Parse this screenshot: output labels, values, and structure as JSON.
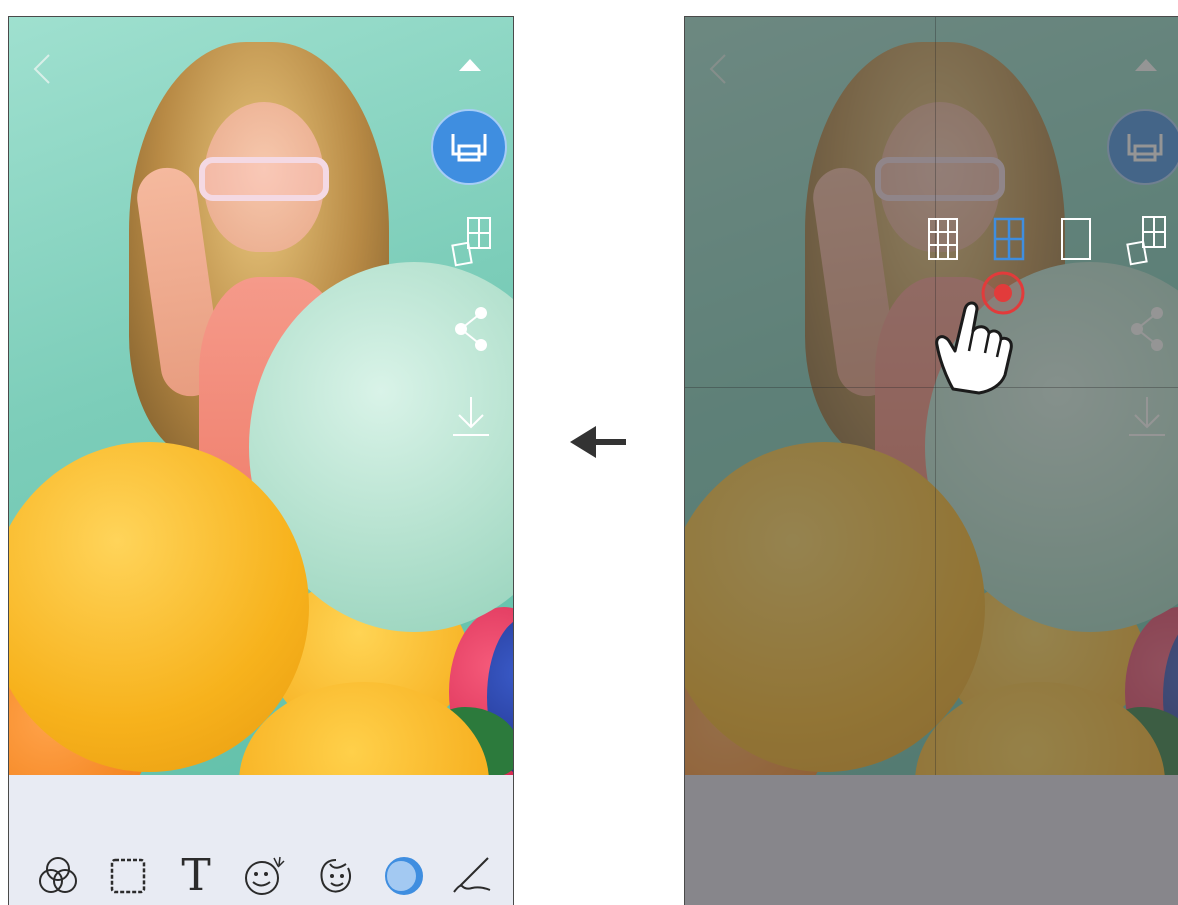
{
  "left_screen": {
    "back_label": "<",
    "collapse_label": "▲",
    "toolbar_right": [
      {
        "name": "print",
        "icon": "printer-icon",
        "active_color": "#3f8ee0"
      },
      {
        "name": "tile-print",
        "icon": "tile-layout-icon"
      },
      {
        "name": "share",
        "icon": "share-icon"
      },
      {
        "name": "save",
        "icon": "download-icon"
      }
    ],
    "bottom_tools": [
      {
        "name": "filter",
        "icon": "filter-circles-icon"
      },
      {
        "name": "frame",
        "icon": "frame-icon"
      },
      {
        "name": "text",
        "icon": "text-icon",
        "label": "T"
      },
      {
        "name": "sticker",
        "icon": "sticker-icon"
      },
      {
        "name": "beauty",
        "icon": "face-icon"
      },
      {
        "name": "effect",
        "icon": "effect-icon",
        "active_color": "#3f8ee0"
      },
      {
        "name": "draw",
        "icon": "pen-icon"
      }
    ]
  },
  "right_screen": {
    "layout_options": [
      {
        "name": "grid-3x3",
        "icon": "grid-9-icon"
      },
      {
        "name": "grid-2x2",
        "icon": "grid-4-icon",
        "selected": true,
        "color": "#3f8ee0"
      },
      {
        "name": "single",
        "icon": "single-frame-icon"
      },
      {
        "name": "tile-menu",
        "icon": "tile-layout-icon"
      }
    ],
    "tap_indicator_color": "#e23b3b"
  },
  "center_arrow": {
    "icon": "arrow-left-icon"
  }
}
